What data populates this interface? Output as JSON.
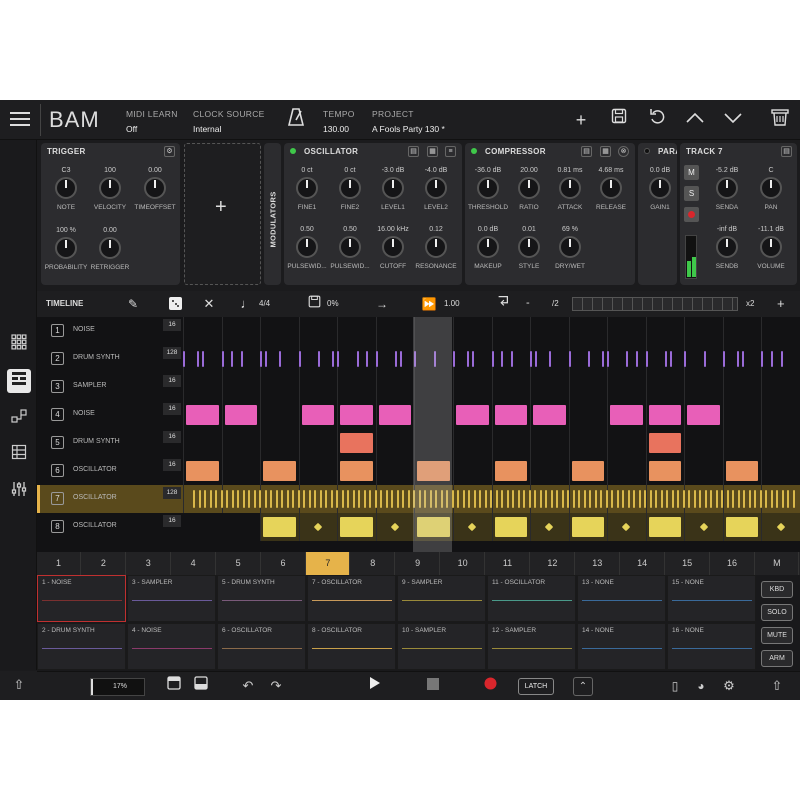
{
  "header": {
    "logo": "BAM",
    "midi_label": "MIDI LEARN",
    "midi_value": "Off",
    "clock_label": "CLOCK SOURCE",
    "clock_value": "Internal",
    "tempo_label": "TEMPO",
    "tempo_value": "130.00",
    "project_label": "PROJECT",
    "project_value": "A Fools Party 130 *"
  },
  "trigger": {
    "title": "TRIGGER",
    "knobs": [
      {
        "val": "C3",
        "lab": "NOTE"
      },
      {
        "val": "100",
        "lab": "VELOCITY"
      },
      {
        "val": "0.00",
        "lab": "TIMEOFFSET"
      },
      {
        "val": "100 %",
        "lab": "PROBABILITY"
      },
      {
        "val": "0.00",
        "lab": "RETRIGGER"
      }
    ]
  },
  "modulators": {
    "label": "MODULATORS",
    "add": "+"
  },
  "oscillator": {
    "title": "OSCILLATOR",
    "knobs": [
      {
        "val": "0 ct",
        "lab": "FINE1"
      },
      {
        "val": "0 ct",
        "lab": "FINE2"
      },
      {
        "val": "-3.0 dB",
        "lab": "LEVEL1"
      },
      {
        "val": "-4.0 dB",
        "lab": "LEVEL2"
      },
      {
        "val": "0.50",
        "lab": "PULSEWID..."
      },
      {
        "val": "0.50",
        "lab": "PULSEWID..."
      },
      {
        "val": "16.00 kHz",
        "lab": "CUTOFF"
      },
      {
        "val": "0.12",
        "lab": "RESONANCE"
      }
    ]
  },
  "compressor": {
    "title": "COMPRESSOR",
    "knobs": [
      {
        "val": "-36.0 dB",
        "lab": "THRESHOLD"
      },
      {
        "val": "20.00",
        "lab": "RATIO"
      },
      {
        "val": "0.81 ms",
        "lab": "ATTACK"
      },
      {
        "val": "4.68 ms",
        "lab": "RELEASE"
      },
      {
        "val": "0.0 dB",
        "lab": "MAKEUP"
      },
      {
        "val": "0.01",
        "lab": "STYLE"
      },
      {
        "val": "69 %",
        "lab": "DRY/WET"
      }
    ]
  },
  "para": {
    "title": "PARA",
    "knobs": [
      {
        "val": "0.0 dB",
        "lab": "GAIN1"
      }
    ]
  },
  "track7": {
    "title": "TRACK 7",
    "m": "M",
    "s": "S",
    "knobs": [
      {
        "val": "-5.2 dB",
        "lab": "SENDA"
      },
      {
        "val": "C",
        "lab": "PAN"
      },
      {
        "val": "-inf dB",
        "lab": "SENDB"
      },
      {
        "val": "-11.1 dB",
        "lab": "VOLUME"
      }
    ]
  },
  "timeline": {
    "title": "TIMELINE",
    "sig": "4/4",
    "swing": "0%",
    "speed": "1.00",
    "div": "/2",
    "mult": "x2",
    "minus": "-",
    "plus": "+"
  },
  "tracks": [
    {
      "n": "1",
      "name": "NOISE",
      "len": "16"
    },
    {
      "n": "2",
      "name": "DRUM SYNTH",
      "len": "128"
    },
    {
      "n": "3",
      "name": "SAMPLER",
      "len": "16"
    },
    {
      "n": "4",
      "name": "NOISE",
      "len": "16"
    },
    {
      "n": "5",
      "name": "DRUM SYNTH",
      "len": "16"
    },
    {
      "n": "6",
      "name": "OSCILLATOR",
      "len": "16"
    },
    {
      "n": "7",
      "name": "OSCILLATOR",
      "len": "128"
    },
    {
      "n": "8",
      "name": "OSCILLATOR",
      "len": "16"
    }
  ],
  "pattern_numbers": [
    "1",
    "2",
    "3",
    "4",
    "5",
    "6",
    "7",
    "8",
    "9",
    "10",
    "11",
    "12",
    "13",
    "14",
    "15",
    "16",
    "M"
  ],
  "patterns": [
    "1 - NOISE",
    "3 - SAMPLER",
    "5 - DRUM SYNTH",
    "7 - OSCILLATOR",
    "9 - SAMPLER",
    "11 - OSCILLATOR",
    "13 - NONE",
    "15 - NONE",
    "2 - DRUM SYNTH",
    "4 - NOISE",
    "6 - OSCILLATOR",
    "8 - OSCILLATOR",
    "10 - SAMPLER",
    "12 - SAMPLER",
    "14 - NONE",
    "16 - NONE"
  ],
  "side_buttons": [
    "KBD",
    "SOLO",
    "MUTE",
    "ARM"
  ],
  "bottom": {
    "cpu": "17%",
    "latch": "LATCH"
  },
  "colors": {
    "purple": "#9a6bd8",
    "pink": "#e85fb8",
    "salmon": "#e8735e",
    "orange": "#e8925f",
    "gold": "#d9b84a",
    "yellow": "#e6d45a",
    "record": "#d9262c",
    "green": "#3fc84a"
  }
}
